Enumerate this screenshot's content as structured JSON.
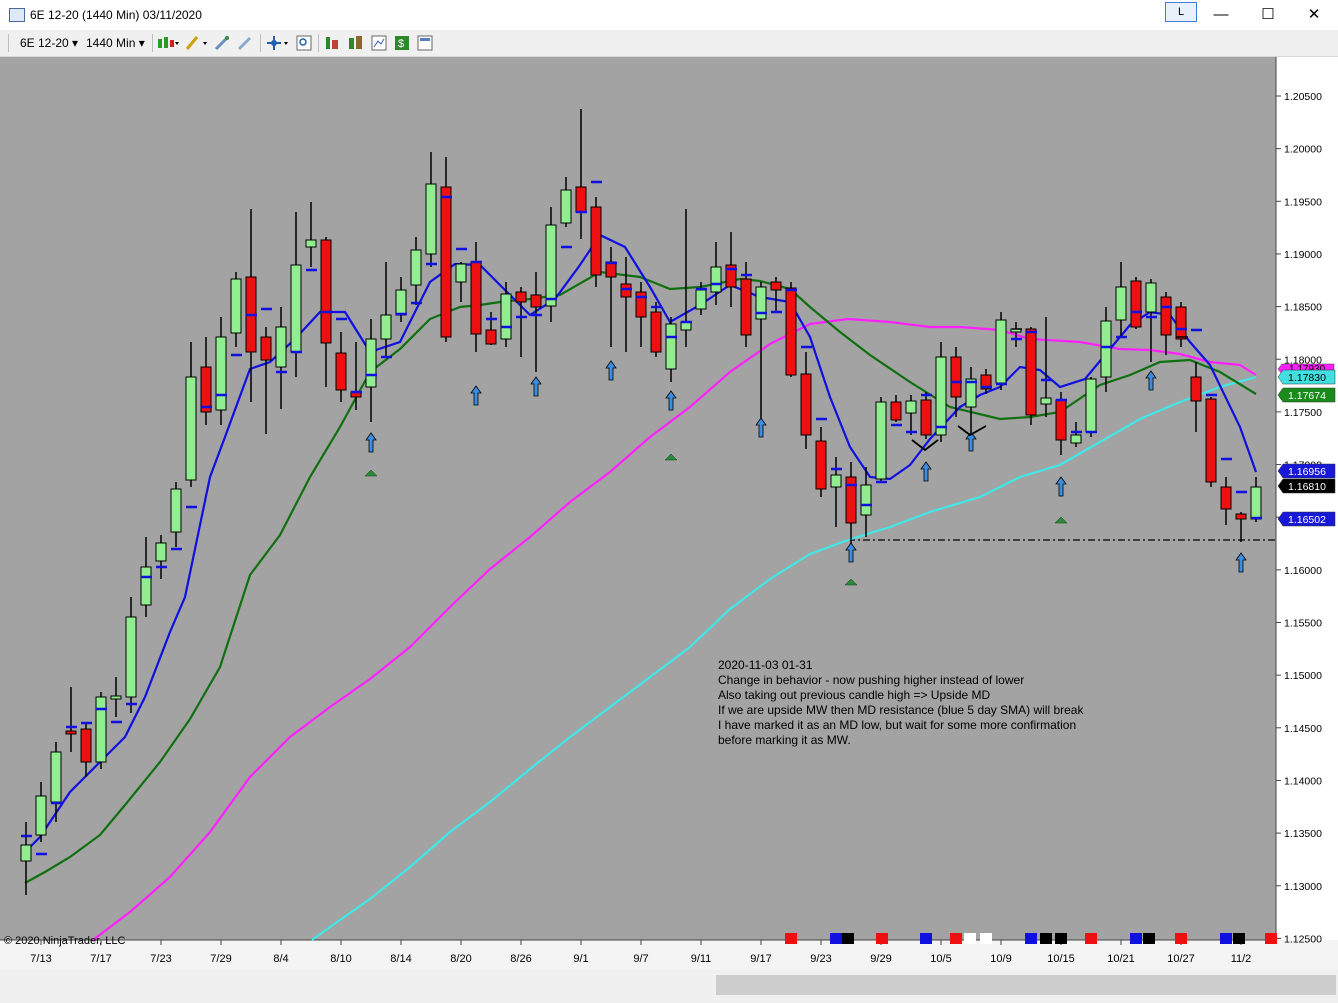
{
  "window": {
    "title": "6E 12-20 (1440 Min)  03/11/2020",
    "l_button": "L",
    "controls": {
      "minimize": "—",
      "maximize": "☐",
      "close": "✕"
    }
  },
  "toolbar": {
    "instrument": "6E 12-20",
    "interval": "1440 Min",
    "icons": [
      "chart-style-icon",
      "drawing-tool-icon",
      "pencil-icon",
      "crosshair-icon",
      "zoom-icon",
      "strategies-icon",
      "indicators-icon",
      "chart-trader-icon",
      "data-box-icon",
      "properties-icon"
    ]
  },
  "chart": {
    "copyright": "© 2020 NinjaTrader, LLC",
    "background": "#a3a3a3",
    "price_axis": [
      "1.20500",
      "1.20000",
      "1.19500",
      "1.19000",
      "1.18500",
      "1.18000",
      "1.17500",
      "1.17000",
      "1.16500",
      "1.16000",
      "1.15500",
      "1.15000",
      "1.14500",
      "1.14000",
      "1.13500",
      "1.13000",
      "1.12500"
    ],
    "date_axis": [
      "7/13",
      "7/17",
      "7/23",
      "7/29",
      "8/4",
      "8/10",
      "8/14",
      "8/20",
      "8/26",
      "9/1",
      "9/7",
      "9/11",
      "9/17",
      "9/23",
      "9/29",
      "10/5",
      "10/9",
      "10/15",
      "10/21",
      "10/27",
      "11/2"
    ],
    "price_flags": [
      {
        "label": "1.17830",
        "color": "#40e0e0"
      },
      {
        "label": "1.17674",
        "color": "#1a8a1a"
      },
      {
        "label": "1.16956",
        "color": "#1818d8"
      },
      {
        "label": "1.16810",
        "color": "#000000"
      },
      {
        "label": "1.16502",
        "color": "#1818d8"
      }
    ],
    "hidden_flag": "1.17930",
    "annotation": [
      "2020-11-03 01-31",
      "Change in behavior - now pushing higher instead of lower",
      "Also taking out previous candle high => Upside MD",
      "If we are upside MW then MD resistance (blue 5 day SMA) will break",
      "I have marked it as an MD low, but wait for some more confirmation",
      "before marking it as MW."
    ],
    "colors": {
      "up": "#90ee90",
      "down": "#ee1010",
      "sma5": "#1010e0",
      "sma_green": "#107010",
      "sma_magenta": "#ff20ff",
      "sma_cyan": "#40e8e8",
      "arrow": "#3a8de0"
    }
  }
}
